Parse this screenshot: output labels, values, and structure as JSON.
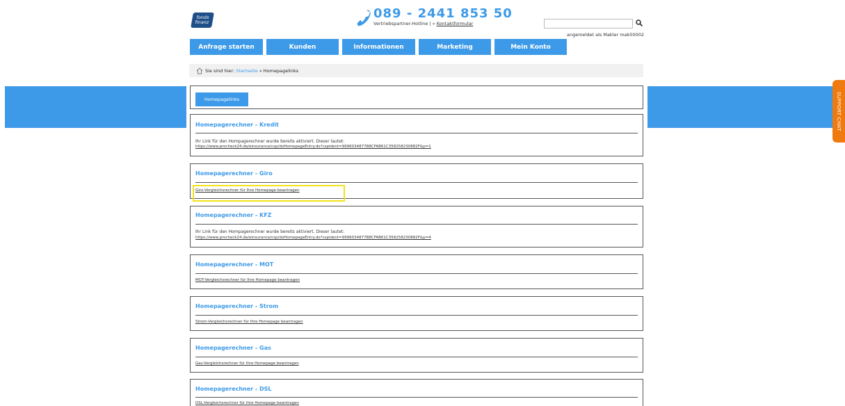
{
  "logo": {
    "line1": "fonds",
    "line2": "finanz"
  },
  "header": {
    "hotline_number": "089 - 2441 853 50",
    "hotline_label": "Vertriebspartner-Hotline | »",
    "contact_link": "Kontaktformular",
    "search_placeholder": "",
    "logged_in": "angemeldet als Makler mak00002"
  },
  "nav": [
    "Anfrage starten",
    "Kunden",
    "Informationen",
    "Marketing",
    "Mein Konto"
  ],
  "breadcrumb": {
    "prefix": "Sie sind hier:",
    "home": "Startseite",
    "separator": "»",
    "current": "Homepagelinks"
  },
  "tab_button": "Homepagelinks",
  "support_chat": "SUPPORT CHAT",
  "sections": [
    {
      "title": "Homepagerechner - Kredit",
      "text": "Ihr Link für den Hompagerechner wurde bereits aktiviert. Dieser lautet:",
      "link": "https://www.procheck24.de/einsurance/csp/doHomepageEntry.do?cspident=9996034877B8CFAB61C358258230882F&p=1"
    },
    {
      "title": "Homepagerechner - Giro",
      "link": "Giro-Vergleichsrechner für Ihre Homepage beantragen"
    },
    {
      "title": "Homepagerechner - KFZ",
      "text": "Ihr Link für den Hompagerechner wurde bereits aktiviert. Dieser lautet:",
      "link": "https://www.procheck24.de/einsurance/csp/doHomepageEntry.do?cspident=9996034877B8CFAB61C358258230882F&p=4"
    },
    {
      "title": "Homepagerechner - MOT",
      "link": "MOT-Vergleichsrechner für Ihre Homepage beantragen"
    },
    {
      "title": "Homepagerechner - Strom",
      "link": "Strom-Vergleichsrechner für Ihre Homepage beantragen"
    },
    {
      "title": "Homepagerechner - Gas",
      "link": "Gas-Vergleichsrechner für Ihre Homepage beantragen"
    },
    {
      "title": "Homepagerechner - DSL",
      "link": "DSL-Vergleichsrechner für Ihre Homepage beantragen"
    }
  ]
}
